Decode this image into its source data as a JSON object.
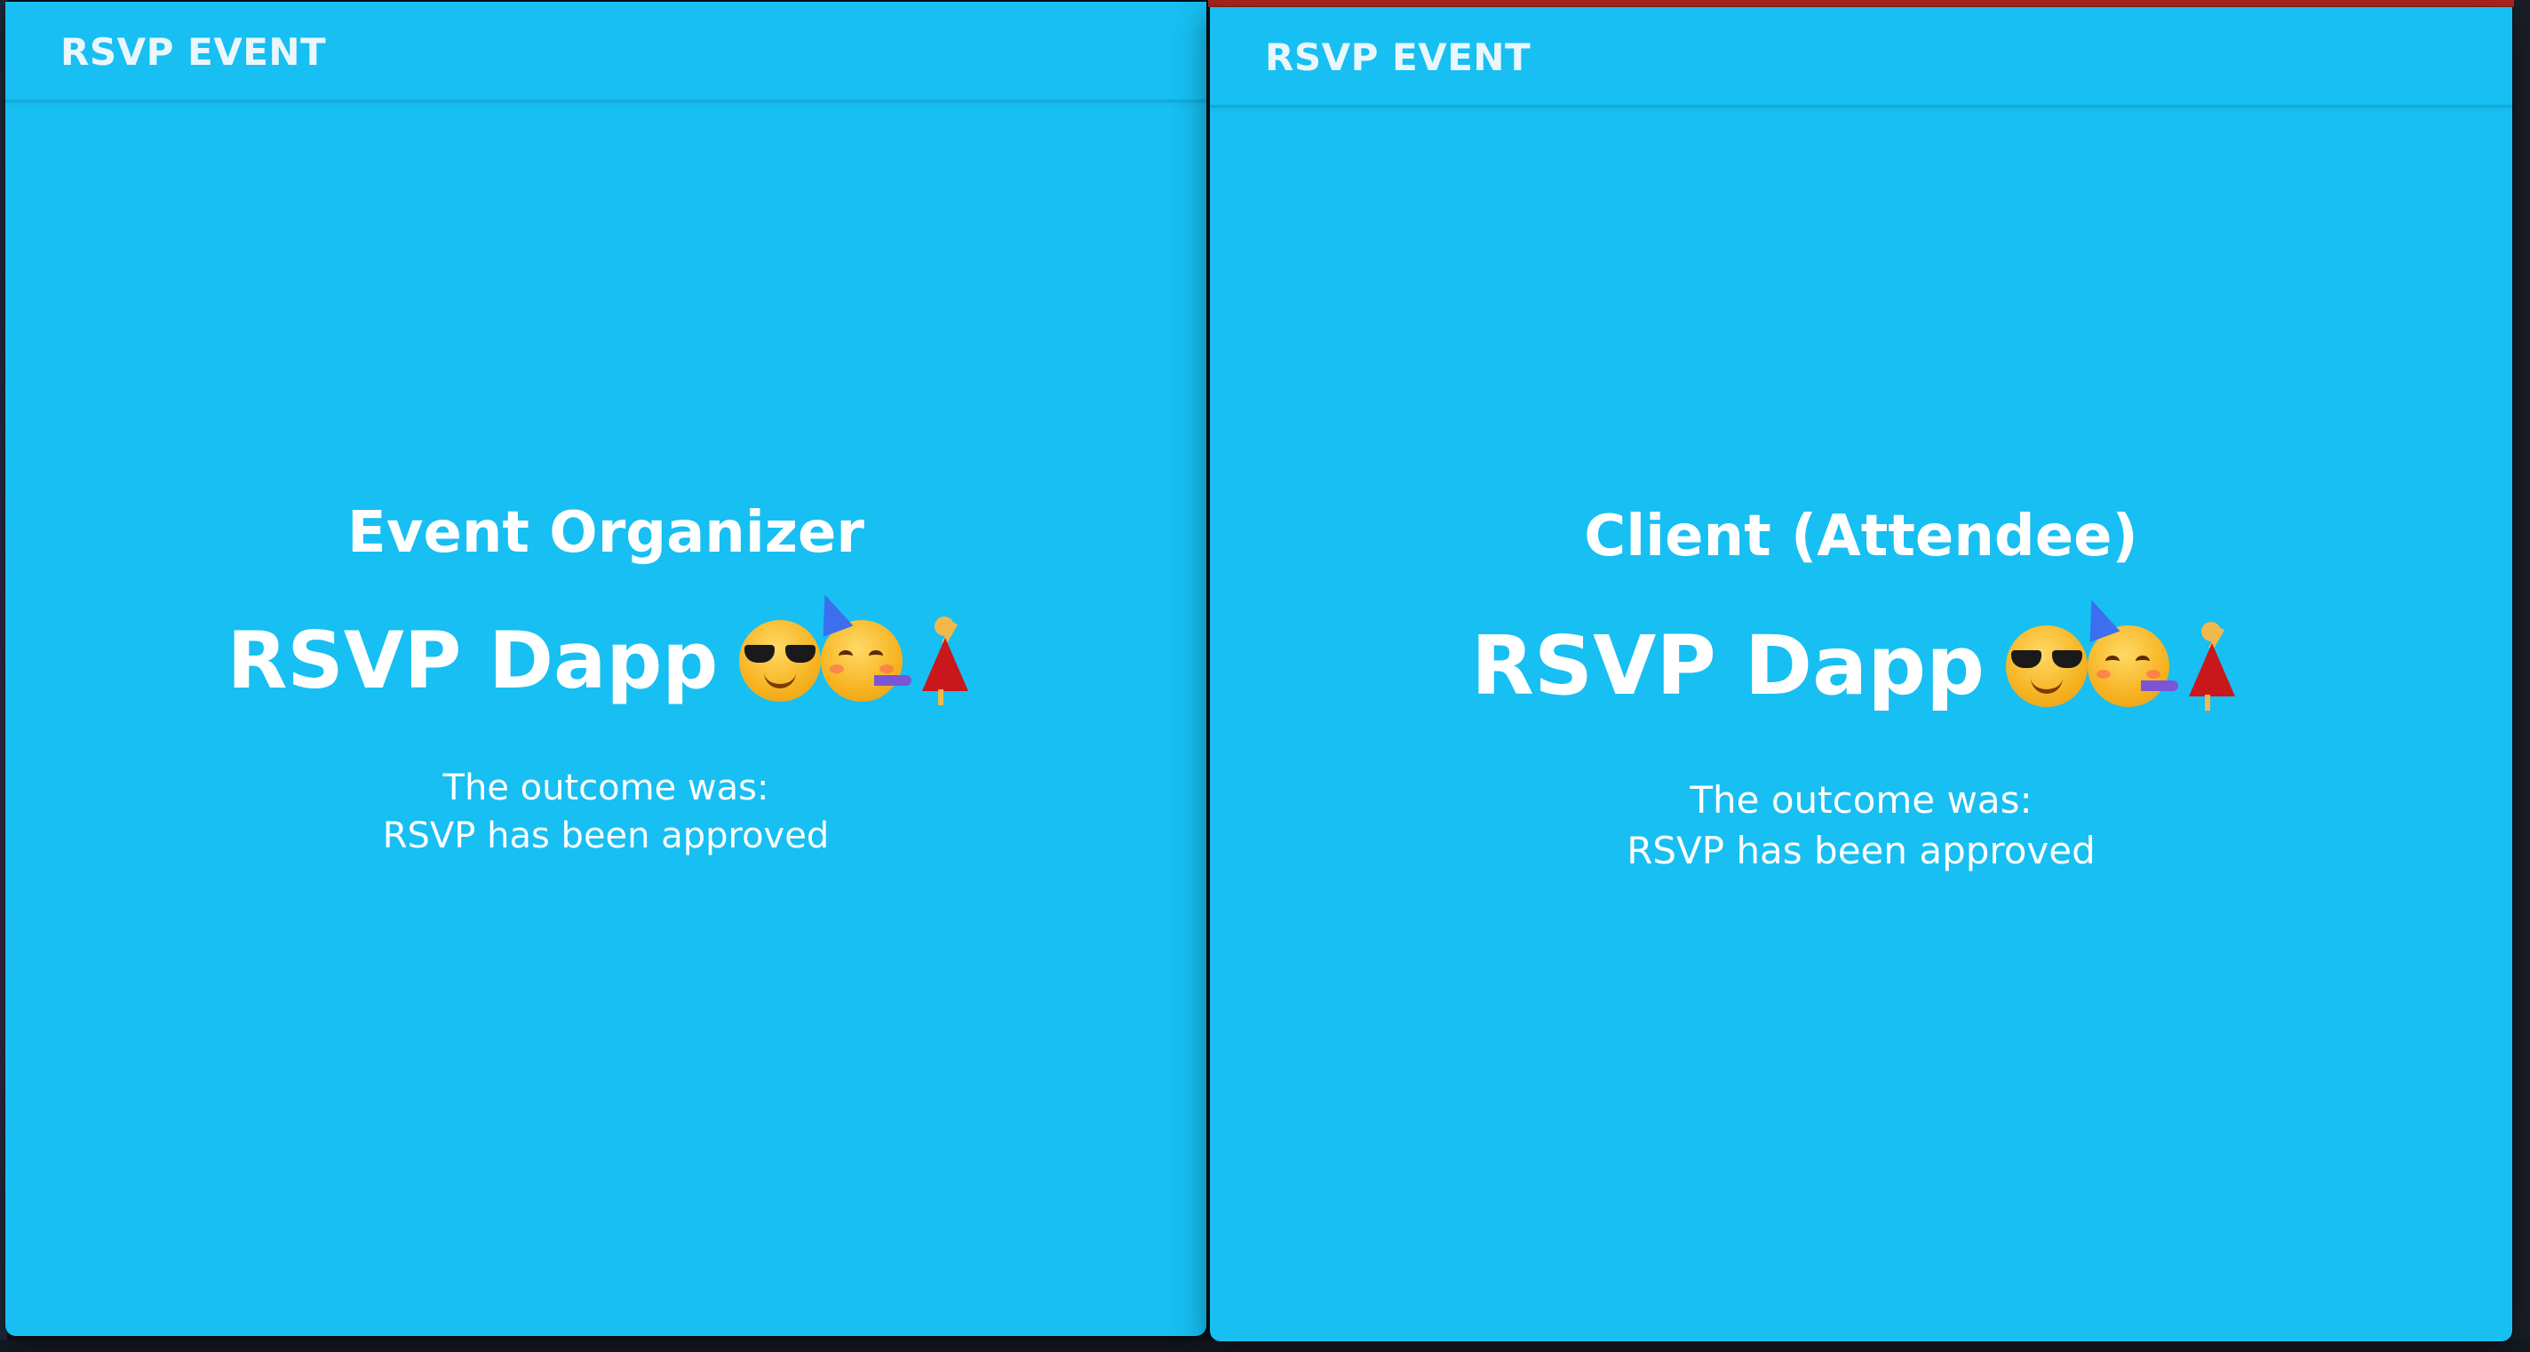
{
  "colors": {
    "window_background": "#17bff2",
    "appbar_divider": "#13a9d8",
    "text": "#ffffff",
    "desktop_background": "#0d1219",
    "top_red_bar": "#b3261e"
  },
  "windows": [
    {
      "appbar_title": "RSVP EVENT",
      "role_heading": "Event Organizer",
      "app_title": "RSVP Dapp",
      "emojis": [
        "smiling-face-with-sunglasses",
        "partying-face",
        "woman-dancing"
      ],
      "outcome_label": "The outcome was:",
      "outcome_value": "RSVP has been approved"
    },
    {
      "appbar_title": "RSVP EVENT",
      "role_heading": "Client (Attendee)",
      "app_title": "RSVP Dapp",
      "emojis": [
        "smiling-face-with-sunglasses",
        "partying-face",
        "woman-dancing"
      ],
      "outcome_label": "The outcome was:",
      "outcome_value": "RSVP has been approved"
    }
  ]
}
